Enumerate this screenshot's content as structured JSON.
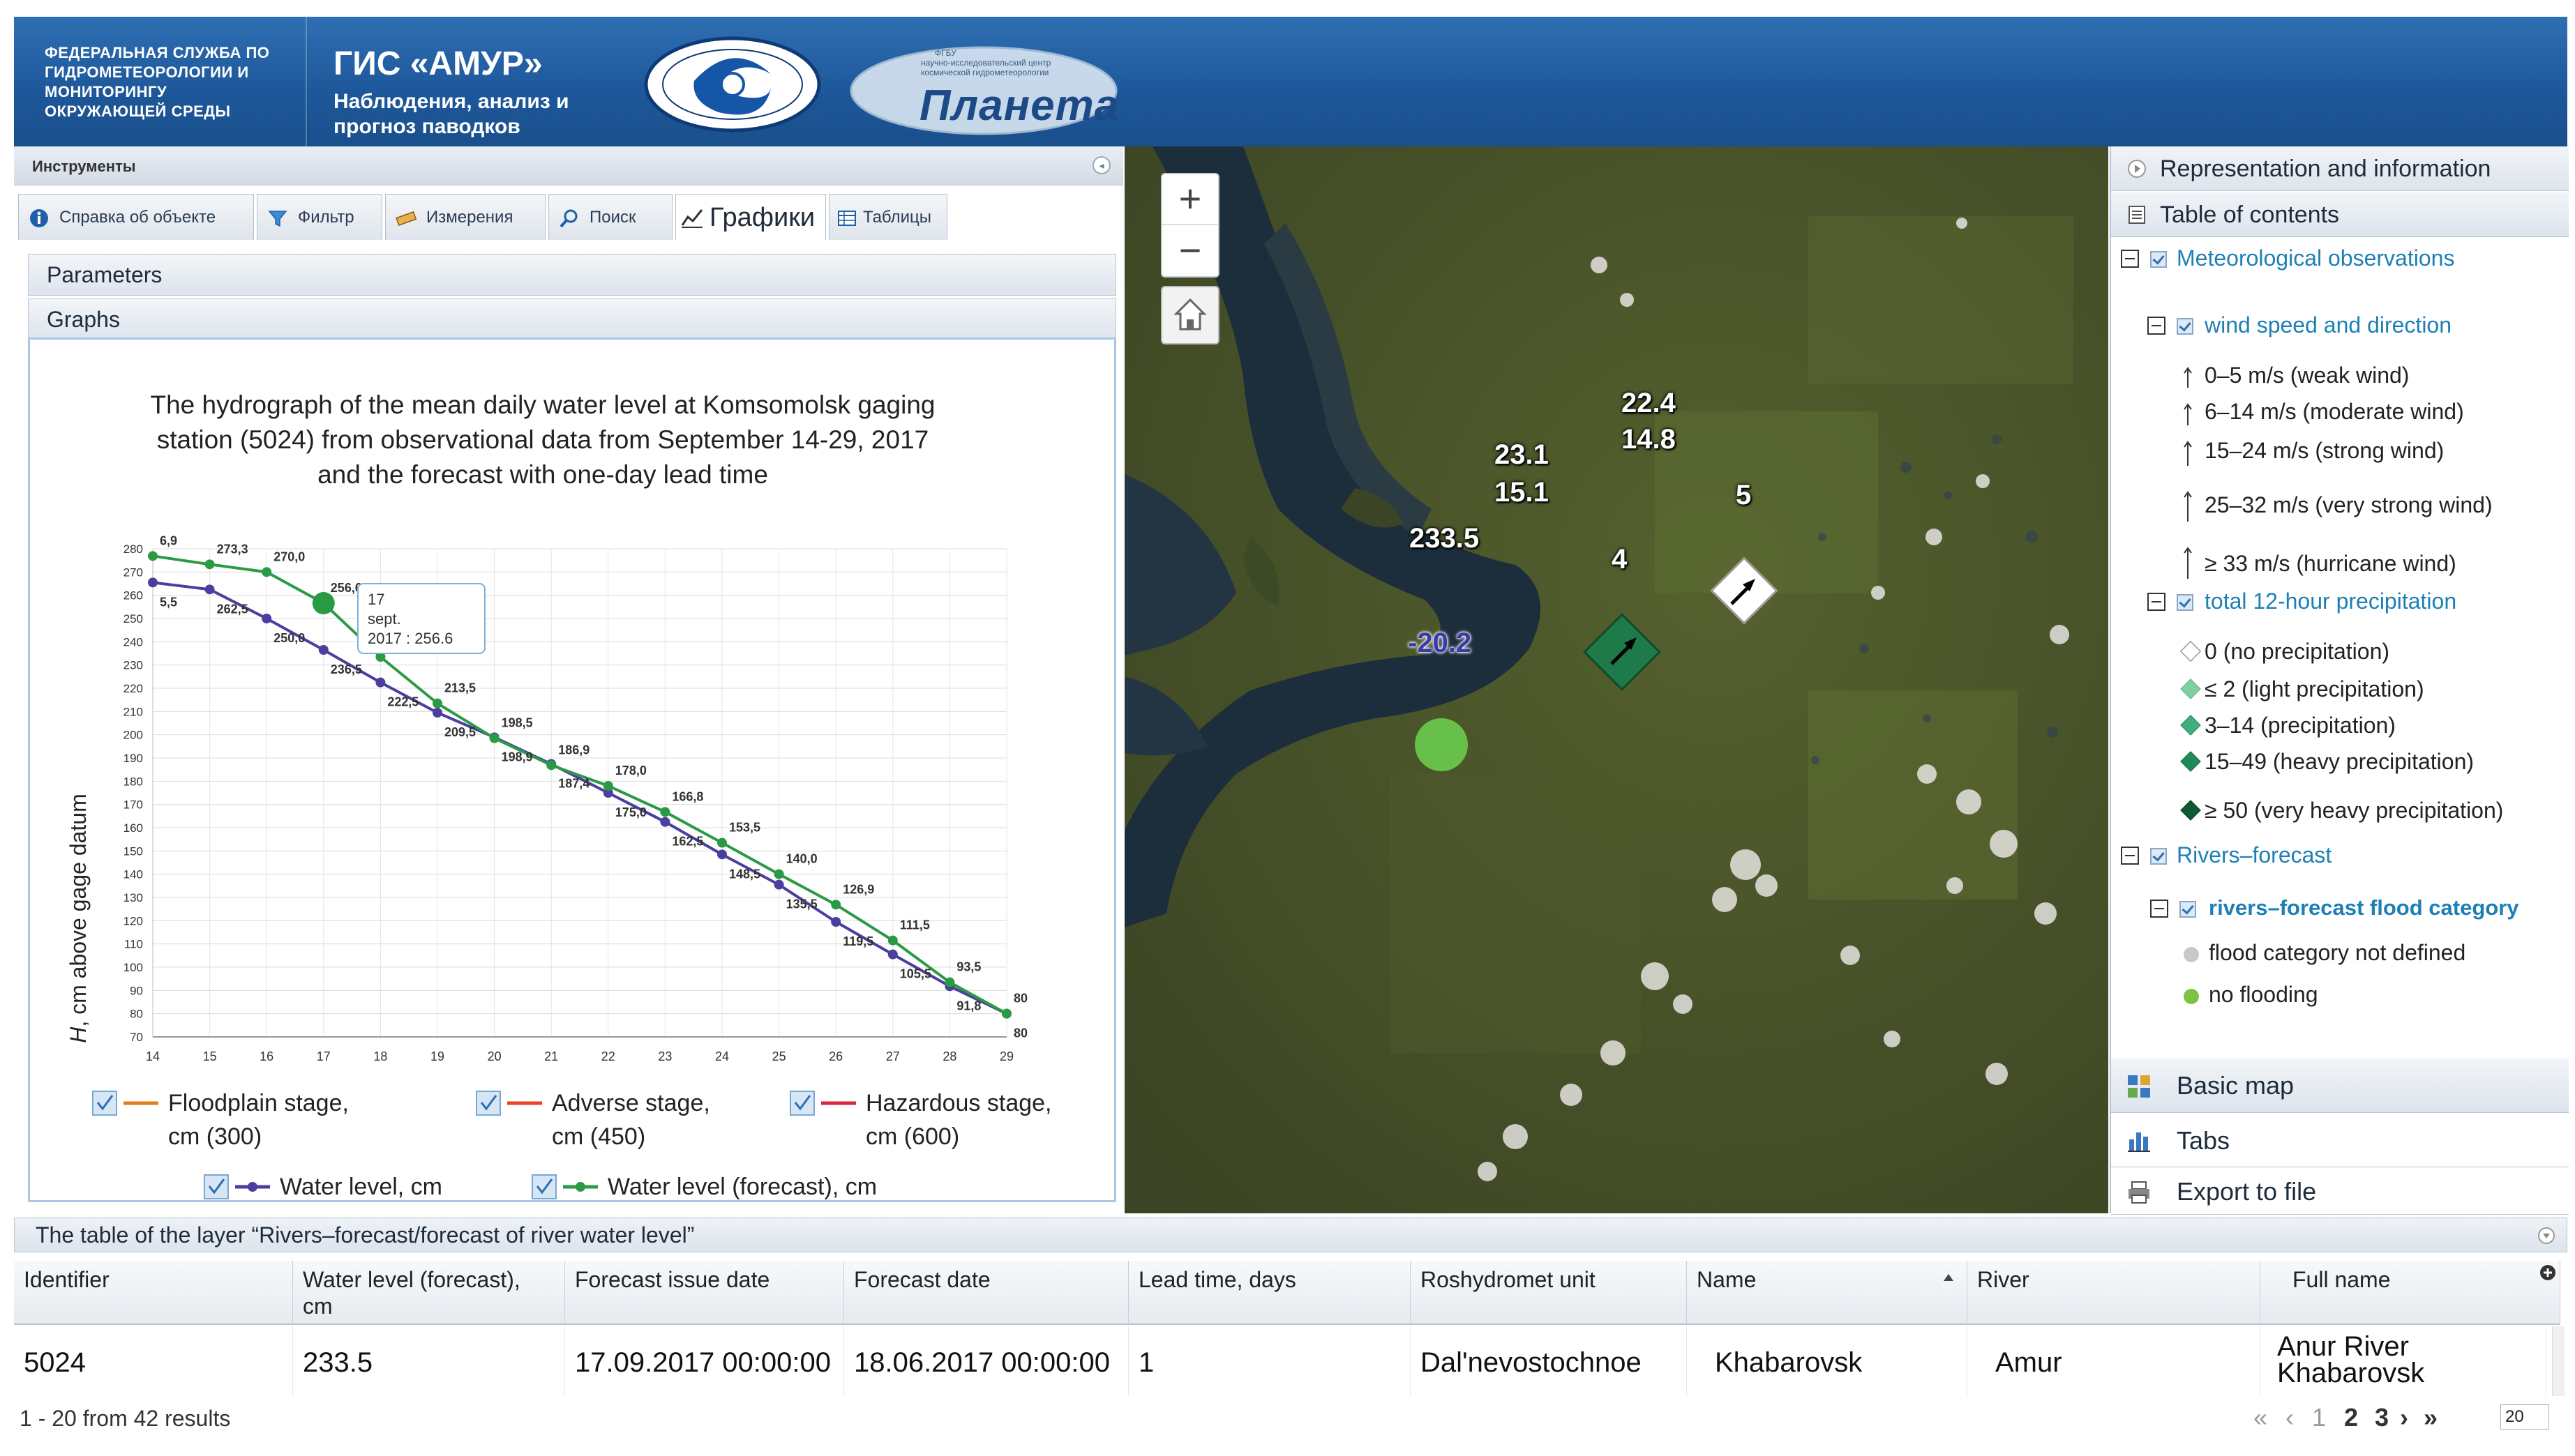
{
  "header": {
    "agency": [
      "ФЕДЕРАЛЬНАЯ СЛУЖБА ПО",
      "ГИДРОМЕТЕОРОЛОГИИ И",
      "МОНИТОРИНГУ",
      "ОКРУЖАЮЩЕЙ СРЕДЫ"
    ],
    "title": "ГИС «АМУР»",
    "subtitle": [
      "Наблюдения, анализ и",
      "прогноз паводков"
    ],
    "logo2_text": "Планета",
    "logo2_small": [
      "ФГБУ",
      "научно-исследовательский центр",
      "космической гидрометеорологии"
    ]
  },
  "tools": {
    "title": "Инструменты",
    "collapse": "◂",
    "tabs": [
      "Справка об объекте",
      "Фильтр",
      "Измерения",
      "Поиск",
      "Графики",
      "Таблицы"
    ]
  },
  "accordion": {
    "parameters": "Parameters",
    "graphs": "Graphs"
  },
  "chart_data": {
    "type": "line",
    "title": [
      "The hydrograph of the mean daily water level at Komsomolsk gaging",
      "station (5024) from observational data from September 14-29, 2017",
      "and the forecast with one-day lead time"
    ],
    "ylabel_italic": "H",
    "ylabel_rest": ", cm above gage datum",
    "x": [
      14,
      15,
      16,
      17,
      18,
      19,
      20,
      21,
      22,
      23,
      24,
      25,
      26,
      27,
      28,
      29
    ],
    "xlim": [
      14,
      29
    ],
    "ylim": [
      70,
      280
    ],
    "yticks": [
      70,
      80,
      90,
      100,
      110,
      120,
      130,
      140,
      150,
      160,
      170,
      180,
      190,
      200,
      210,
      220,
      230,
      240,
      250,
      260,
      270,
      280
    ],
    "grid": true,
    "series": [
      {
        "name": "Water level, cm",
        "color": "#4a3f9e",
        "values": [
          265.5,
          262.5,
          250.0,
          236.5,
          222.5,
          209.5,
          198.9,
          187.4,
          175.0,
          162.5,
          148.5,
          135.5,
          119.5,
          105.5,
          91.8,
          80
        ],
        "labels": [
          "5,5",
          "262,5",
          "250,0",
          "236,5",
          "222,5",
          "209,5",
          "198,9",
          "187,4",
          "175,0",
          "162,5",
          "148,5",
          "135,5",
          "119,5",
          "105,5",
          "91,8",
          "80"
        ]
      },
      {
        "name": "Water level (forecast), cm",
        "color": "#2a9a45",
        "values": [
          276.9,
          273.3,
          270.0,
          256.6,
          233.5,
          213.5,
          198.5,
          186.9,
          178.0,
          166.8,
          153.5,
          140.0,
          126.9,
          111.5,
          93.5,
          80
        ],
        "labels": [
          "6,9",
          "273,3",
          "270,0",
          "256,6",
          "233,5",
          "213,5",
          "198,5",
          "186,9",
          "178,0",
          "166,8",
          "153,5",
          "140,0",
          "126,9",
          "111,5",
          "93,5",
          "80"
        ]
      }
    ],
    "tooltip": {
      "line1": "17",
      "line2": "sept.",
      "line3": "2017 : 256.6"
    },
    "legend": [
      {
        "label": [
          "Floodplain stage,",
          "cm (300)"
        ],
        "color": "#e07b20"
      },
      {
        "label": [
          "Adverse stage,",
          "cm (450)"
        ],
        "color": "#e8432a"
      },
      {
        "label": [
          "Hazardous stage,",
          "cm (600)"
        ],
        "color": "#d7263d"
      },
      {
        "label": [
          "Water level, cm"
        ],
        "color": "#4a3f9e"
      },
      {
        "label": [
          "Water level (forecast), cm"
        ],
        "color": "#2a9a45"
      }
    ]
  },
  "map": {
    "zoom_in": "+",
    "zoom_out": "−",
    "stations": [
      {
        "top": "233.5",
        "bottom": "-20.2"
      },
      {
        "top": "23.1",
        "mid": "15.1",
        "id": "4"
      },
      {
        "top": "22.4",
        "mid": "14.8",
        "id": "5"
      }
    ]
  },
  "right": {
    "representation": "Representation and information",
    "toc_title": "Table of contents",
    "met_obs": "Meteorological observations",
    "wind_group": "wind speed and direction",
    "wind_items": [
      "0–5 m/s (weak wind)",
      "6–14 m/s (moderate wind)",
      "15–24 m/s (strong wind)",
      "25–32 m/s (very strong wind)",
      "≥ 33 m/s (hurricane wind)"
    ],
    "precip_group": "total 12-hour precipitation",
    "precip_items": [
      "0 (no precipitation)",
      "≤ 2 (light precipitation)",
      "3–14 (precipitation)",
      "15–49 (heavy precipitation)",
      "≥ 50 (very heavy precipitation)"
    ],
    "precip_colors": [
      "#ffffff",
      "#7fd0a0",
      "#3fae7a",
      "#1e8a55",
      "#0f5a33"
    ],
    "rivers": "Rivers–forecast",
    "rivers_sub": "rivers–forecast flood category",
    "flood_items": [
      "flood category not defined",
      "no flooding"
    ],
    "flood_colors": [
      "#c8c8c8",
      "#7dc242"
    ],
    "basic_map": "Basic map",
    "tabs": "Tabs",
    "export": "Export to file"
  },
  "table": {
    "title": "The table of the layer “Rivers–forecast/forecast of river water level”",
    "headers": [
      "Identifier",
      "Water level (forecast), cm",
      "Forecast issue date",
      "Forecast date",
      "Lead time, days",
      "Roshydromet unit",
      "Name",
      "River",
      "Full name"
    ],
    "row": [
      "5024",
      "233.5",
      "17.09.2017 00:00:00",
      "18.06.2017 00:00:00",
      "1",
      "Dal'nevostochnoe",
      "Khabarovsk",
      "Amur",
      "Anur River",
      "Khabarovsk"
    ],
    "pager_text": "1 - 20 from 42 results",
    "pages": [
      "1",
      "2",
      "3"
    ],
    "page_size": "20"
  }
}
